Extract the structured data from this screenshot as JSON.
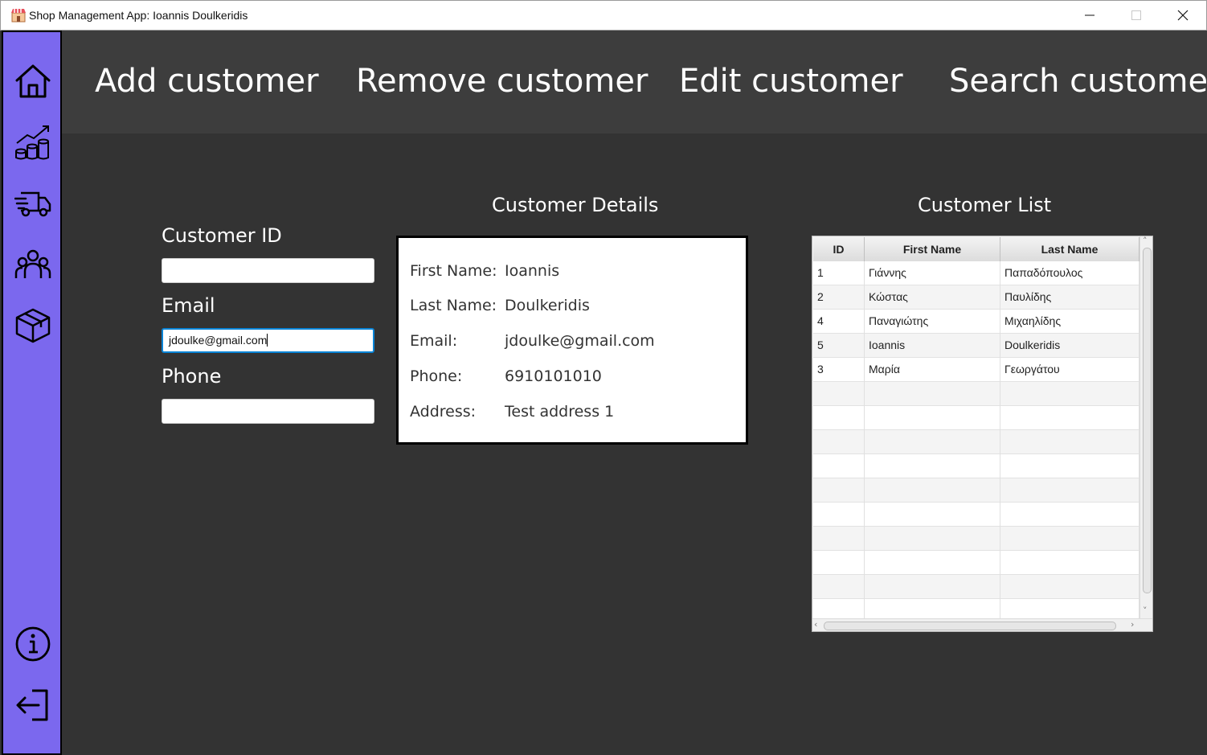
{
  "window": {
    "title": "Shop Management App: Ioannis Doulkeridis",
    "icon": "shop-icon"
  },
  "sidebar": {
    "color": "#7b68ee",
    "items": [
      {
        "icon": "home-icon"
      },
      {
        "icon": "sales-chart-icon"
      },
      {
        "icon": "delivery-truck-icon"
      },
      {
        "icon": "customers-icon"
      },
      {
        "icon": "box-icon"
      },
      {
        "icon": "info-icon"
      },
      {
        "icon": "logout-icon"
      }
    ]
  },
  "topbar": {
    "add": "Add customer",
    "remove": "Remove customer",
    "edit": "Edit customer",
    "search": "Search customer"
  },
  "form": {
    "customer_id_label": "Customer ID",
    "customer_id_value": "",
    "email_label": "Email",
    "email_value": "jdoulke@gmail.com",
    "phone_label": "Phone",
    "phone_value": ""
  },
  "details": {
    "title": "Customer Details",
    "rows": [
      {
        "label": "First Name:",
        "value": "Ioannis"
      },
      {
        "label": "Last Name:",
        "value": "Doulkeridis"
      },
      {
        "label": "Email:",
        "value": "jdoulke@gmail.com"
      },
      {
        "label": "Phone:",
        "value": "6910101010"
      },
      {
        "label": "Address:",
        "value": "Test address 1"
      }
    ]
  },
  "list": {
    "title": "Customer List",
    "columns": [
      "ID",
      "First Name",
      "Last Name"
    ],
    "rows": [
      [
        "1",
        "Γιάννης",
        "Παπαδόπουλος"
      ],
      [
        "2",
        "Κώστας",
        "Παυλίδης"
      ],
      [
        "4",
        "Παναγιώτης",
        "Μιχαηλίδης"
      ],
      [
        "5",
        "Ioannis",
        "Doulkeridis"
      ],
      [
        "3",
        "Μαρία",
        "Γεωργάτου"
      ]
    ]
  }
}
